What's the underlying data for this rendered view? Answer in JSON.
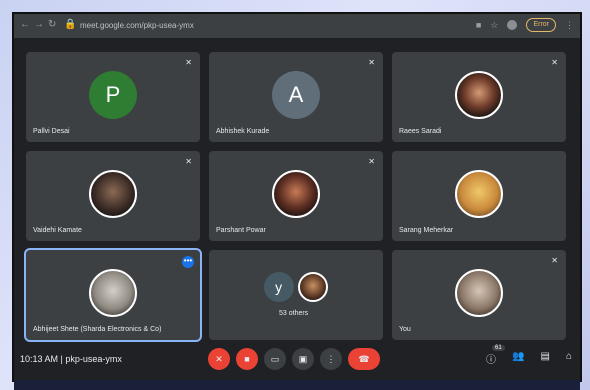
{
  "browser": {
    "url": "meet.google.com/pkp-usea-ymx",
    "pill": "Error"
  },
  "participants": [
    {
      "name": "Pallvi Desai",
      "initial": "P",
      "color": "#2e7d32"
    },
    {
      "name": "Abhishek Kurade",
      "initial": "A",
      "color": "#5f6e78"
    },
    {
      "name": "Raees Saradi",
      "initial": ""
    },
    {
      "name": "Vaidehi Kamate",
      "initial": ""
    },
    {
      "name": "Parshant Powar",
      "initial": ""
    },
    {
      "name": "Sarang Meherkar",
      "initial": ""
    },
    {
      "name": "Abhijeet Shete (Sharda Electronics & Co)",
      "initial": ""
    },
    {
      "name": "53 others",
      "initial": "y"
    },
    {
      "name": "You",
      "initial": ""
    }
  ],
  "footer": {
    "time": "10:13 AM",
    "separator": "|",
    "meeting_code": "pkp-usea-ymx",
    "people_count": "61"
  }
}
